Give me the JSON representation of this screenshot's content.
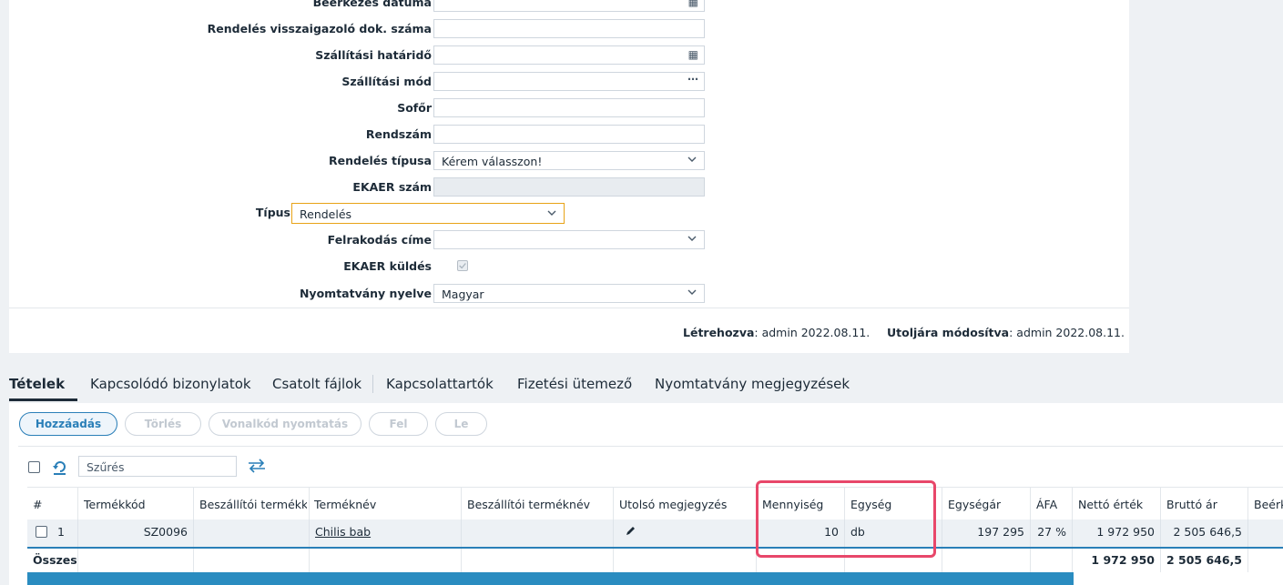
{
  "form": {
    "beerkezes_datuma": "Beérkezés dátuma",
    "visszaigazolo": "Rendelés visszaigazoló dok. száma",
    "szallitasi_hatarido": "Szállítási határidő",
    "szallitasi_mod": "Szállítási mód",
    "sofor": "Sofőr",
    "rendszam": "Rendszám",
    "rendeles_tipusa": "Rendelés típusa",
    "rendeles_tipusa_value": "Kérem válasszon!",
    "ekaer_szam": "EKAER szám",
    "tipus": "Típus",
    "tipus_value": "Rendelés",
    "felrakodas_cime": "Felrakodás címe",
    "ekaer_kuldes": "EKAER küldés",
    "nyomtatvany_nyelve": "Nyomtatvány nyelve",
    "nyomtatvany_nyelve_value": "Magyar"
  },
  "meta": {
    "created_label": "Létrehozva",
    "created_value": ": admin 2022.08.11.",
    "modified_label": "Utoljára módosítva",
    "modified_value": ": admin 2022.08.11."
  },
  "tabs": [
    "Tételek",
    "Kapcsolódó bizonylatok",
    "Csatolt fájlok",
    "Kapcsolattartók",
    "Fizetési ütemező",
    "Nyomtatvány megjegyzések"
  ],
  "toolbar": {
    "add": "Hozzáadás",
    "delete": "Törlés",
    "barcode": "Vonalkód nyomtatás",
    "up": "Fel",
    "down": "Le"
  },
  "filter": {
    "placeholder": "Szűrés"
  },
  "grid": {
    "headers": [
      "#",
      "Termékkód",
      "Beszállítói termékk",
      "Terméknév",
      "Beszállítói terméknév",
      "Utolsó megjegyzés",
      "Mennyiség",
      "Egység",
      "Egységár",
      "ÁFA",
      "Nettó érték",
      "Bruttó ár",
      "Beérk"
    ],
    "row": {
      "index": "1",
      "code": "SZ0096",
      "name": "Chilis bab",
      "quantity": "10",
      "unit": "db",
      "unit_price": "197 295",
      "vat": "27 %",
      "net": "1 972 950",
      "gross": "2 505 646,5"
    },
    "total": {
      "label": "Összesen",
      "net": "1 972 950",
      "gross": "2 505 646,5"
    }
  },
  "colors": {
    "accent": "#2a7fb8",
    "highlight": "#e8476a",
    "focus": "#e8a317"
  }
}
